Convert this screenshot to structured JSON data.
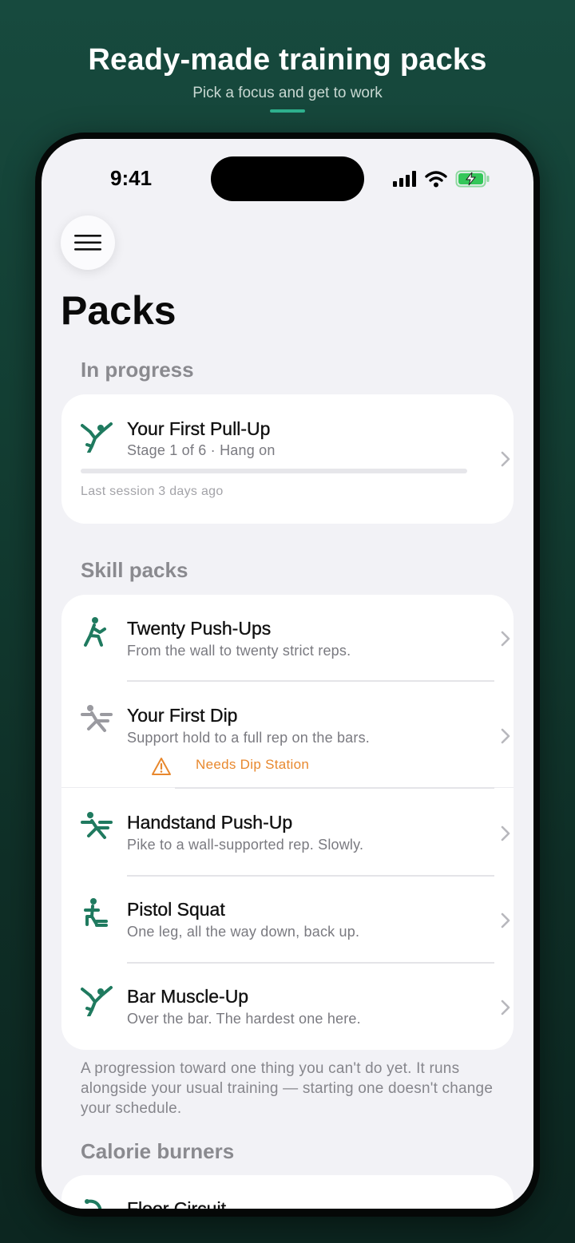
{
  "promo": {
    "title": "Ready-made training packs",
    "subtitle": "Pick a focus and get to work"
  },
  "status_bar": {
    "time": "9:41",
    "icons": [
      "cellular-signal-icon",
      "wifi-icon",
      "battery-charging-icon"
    ]
  },
  "page": {
    "title": "Packs",
    "menu_icon": "hamburger-menu-icon"
  },
  "in_progress": {
    "header": "In progress",
    "item": {
      "title": "Your First Pull-Up",
      "subtitle": "Stage 1 of 6 · Hang on",
      "progress": 0,
      "last_session": "Last session 3 days ago",
      "icon": "pull-up-icon"
    }
  },
  "skill_packs": {
    "header": "Skill packs",
    "items": [
      {
        "title": "Twenty Push-Ups",
        "subtitle": "From the wall to twenty strict reps.",
        "icon": "push-up-icon"
      },
      {
        "title": "Your First Dip",
        "subtitle": "Support hold to a full rep on the bars.",
        "icon": "dip-icon",
        "warning": "Needs Dip Station",
        "warning_icon": "warning-triangle-icon",
        "warning_color": "#e8882e"
      },
      {
        "title": "Handstand Push-Up",
        "subtitle": "Pike to a wall-supported rep. Slowly.",
        "icon": "handstand-icon"
      },
      {
        "title": "Pistol Squat",
        "subtitle": "One leg, all the way down, back up.",
        "icon": "squat-icon"
      },
      {
        "title": "Bar Muscle-Up",
        "subtitle": "Over the bar. The hardest one here.",
        "icon": "muscle-up-icon"
      }
    ],
    "footnote": "A progression toward one thing you can't do yet. It runs alongside your usual training — starting one doesn't change your schedule."
  },
  "calorie_burners": {
    "header": "Calorie burners",
    "items": [
      {
        "title": "Floor Circuit",
        "icon": "circuit-icon"
      }
    ]
  },
  "colors": {
    "accent": "#1f7a5f",
    "background_top": "#174a3e",
    "screen_bg": "#f2f2f6",
    "muted_icon": "#9a9aa0",
    "warning": "#e8882e"
  }
}
